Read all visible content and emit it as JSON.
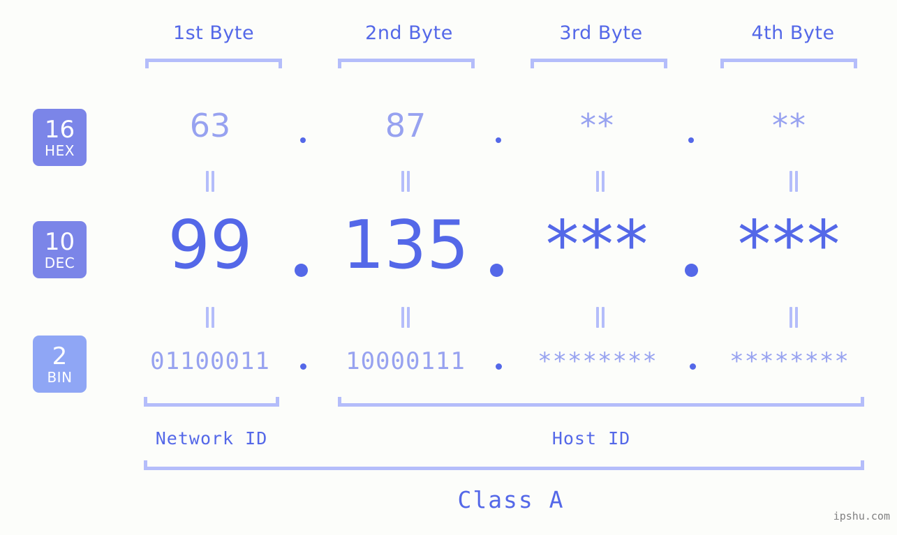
{
  "header": {
    "byte_labels": [
      {
        "label": "1st Byte"
      },
      {
        "label": "2nd Byte"
      },
      {
        "label": "3rd Byte"
      },
      {
        "label": "4th Byte"
      }
    ]
  },
  "bases": [
    {
      "number": "16",
      "name": "HEX",
      "color": "#7b85e8"
    },
    {
      "number": "10",
      "name": "DEC",
      "color": "#7b85e8"
    },
    {
      "number": "2",
      "name": "BIN",
      "color": "#8fa6f5"
    }
  ],
  "rows": {
    "hex": {
      "base_number": "16",
      "base_name": "HEX",
      "values": [
        "63",
        "87",
        "**",
        "**"
      ],
      "separator": "."
    },
    "dec": {
      "base_number": "10",
      "base_name": "DEC",
      "values": [
        "99",
        "135",
        "***",
        "***"
      ],
      "separator": "."
    },
    "bin": {
      "base_number": "2",
      "base_name": "BIN",
      "values": [
        "01100011",
        "10000111",
        "********",
        "********"
      ],
      "separator": "."
    }
  },
  "equals_symbol": "||",
  "footer": {
    "network_id_label": "Network ID",
    "host_id_label": "Host ID",
    "class_label": "Class A"
  },
  "watermark": "ipshu.com",
  "colors": {
    "background": "#fcfdfa",
    "accent_strong": "#5468e8",
    "accent_light": "#97a2f0",
    "bracket": "#b4bdfa",
    "badge_hex": "#7b85e8",
    "badge_dec": "#7b85e8",
    "badge_bin": "#8fa6f5",
    "watermark": "#808080"
  }
}
